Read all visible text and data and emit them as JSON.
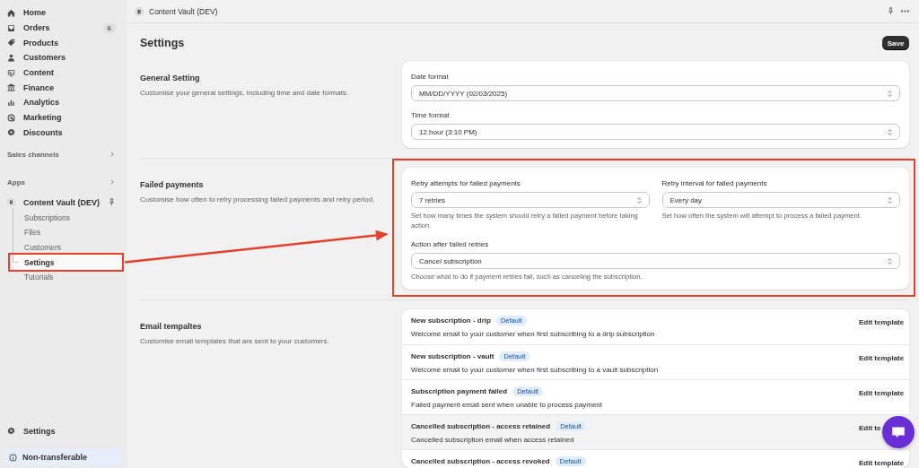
{
  "header": {
    "title": "Content Vault (DEV)"
  },
  "sidebar": {
    "nav": [
      {
        "label": "Home",
        "selected": false
      },
      {
        "label": "Orders",
        "badge": "6",
        "selected": false
      },
      {
        "label": "Products",
        "selected": false
      },
      {
        "label": "Customers",
        "selected": false
      },
      {
        "label": "Content",
        "selected": false
      },
      {
        "label": "Finance",
        "selected": false
      },
      {
        "label": "Analytics",
        "selected": false
      },
      {
        "label": "Marketing",
        "selected": false
      },
      {
        "label": "Discounts",
        "selected": false
      }
    ],
    "groups": [
      {
        "label": "Sales channels"
      },
      {
        "label": "Apps"
      }
    ],
    "app": {
      "name": "Content Vault (DEV)",
      "children": [
        {
          "label": "Subscriptions",
          "selected": false,
          "annotated": false
        },
        {
          "label": "Files",
          "selected": false,
          "annotated": false
        },
        {
          "label": "Customers",
          "selected": false,
          "annotated": false
        },
        {
          "label": "Settings",
          "selected": true,
          "annotated": true
        },
        {
          "label": "Tutorials",
          "selected": false,
          "annotated": false
        }
      ]
    },
    "footer": {
      "settings": "Settings",
      "notice": "Non-transferable"
    }
  },
  "page": {
    "title": "Settings",
    "save_button": "Save"
  },
  "sections": [
    {
      "kind": "fields",
      "title": "General Setting",
      "description": "Customise your general settings, including time and date formats.",
      "annotated": false,
      "rows": [
        [
          {
            "label": "Date format",
            "value": "MM/DD/YYYY (02/03/2025)"
          }
        ],
        [
          {
            "label": "Time format",
            "value": "12 hour (3:10 PM)"
          }
        ]
      ]
    },
    {
      "kind": "fields",
      "title": "Failed payments",
      "description": "Customise how often to retry processing failed payments and retry period.",
      "annotated": true,
      "rows": [
        [
          {
            "label": "Retry attempts for failed payments",
            "value": "7 retries",
            "help": "Set how many times the system should retry a failed payment before taking action."
          },
          {
            "label": "Retry interval for failed payments",
            "value": "Every day",
            "help": "Set how often the system will attempt to process a failed payment."
          }
        ],
        [
          {
            "label": "Action after failed retries",
            "value": "Cancel subscription",
            "help": "Choose what to do if payment retries fail, such as canceling the subscription."
          }
        ]
      ]
    },
    {
      "kind": "templates",
      "title": "Email tempaltes",
      "description": "Customise email templates that are sent to your customers.",
      "annotated": false,
      "rows": [
        {
          "title": "New subscription - drip",
          "badge": "Default",
          "description": "Welcome email to your customer when first subscribing to a drip subscription",
          "action": "Edit template",
          "highlighted": false
        },
        {
          "title": "New subscription - vault",
          "badge": "Default",
          "description": "Welcome email to your customer when first subscribing to a vault subscription",
          "action": "Edit template",
          "highlighted": false
        },
        {
          "title": "Subscription payment failed",
          "badge": "Default",
          "description": "Failed payment email sent when unable to process payment",
          "action": "Edit template",
          "highlighted": false
        },
        {
          "title": "Cancelled subscription - access retained",
          "badge": "Default",
          "description": "Cancelled subscription email when access retained",
          "action": "Edit te",
          "highlighted": true
        },
        {
          "title": "Cancelled subscription - access revoked",
          "badge": "Default",
          "action": "Edit template",
          "highlighted": false
        }
      ]
    }
  ]
}
